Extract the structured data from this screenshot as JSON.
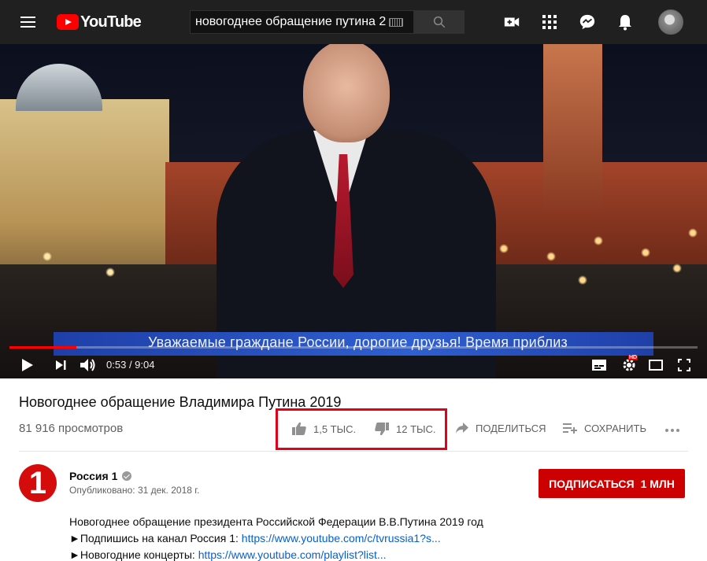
{
  "header": {
    "logo_text": "YouTube",
    "search_value": "новогоднее обращение путина 2",
    "colors": {
      "bg": "#202020",
      "brand": "#ff0000"
    },
    "icons": [
      "menu-icon",
      "keyboard-icon",
      "search-icon",
      "create-video-icon",
      "apps-icon",
      "messages-icon",
      "notifications-icon"
    ]
  },
  "player": {
    "caption": "Уважаемые граждане России, дорогие друзья! Время приблиз",
    "time_current": "0:53",
    "time_total": "9:04",
    "progress_fraction": 0.097,
    "hd_badge": "HD"
  },
  "video": {
    "title": "Новогоднее обращение Владимира Путина 2019",
    "views": "81 916 просмотров",
    "likes": "1,5 ТЫС.",
    "dislikes": "12 ТЫС.",
    "share_label": "ПОДЕЛИТЬСЯ",
    "save_label": "СОХРАНИТЬ"
  },
  "channel": {
    "name": "Россия 1",
    "logo_text": "1",
    "published": "Опубликовано: 31 дек. 2018 г.",
    "subscribe_label": "ПОДПИСАТЬСЯ",
    "subscribers": "1 МЛН",
    "accent": "#cc0000"
  },
  "description": {
    "line1": "Новогоднее обращение президента Российской Федерации В.В.Путина 2019 год",
    "line2_prefix": "►Подпишись на канал Россия 1: ",
    "line2_link": "https://www.youtube.com/c/tvrussia1?s...",
    "line3_prefix": "►Новогодние концерты: ",
    "line3_link": "https://www.youtube.com/playlist?list..."
  }
}
